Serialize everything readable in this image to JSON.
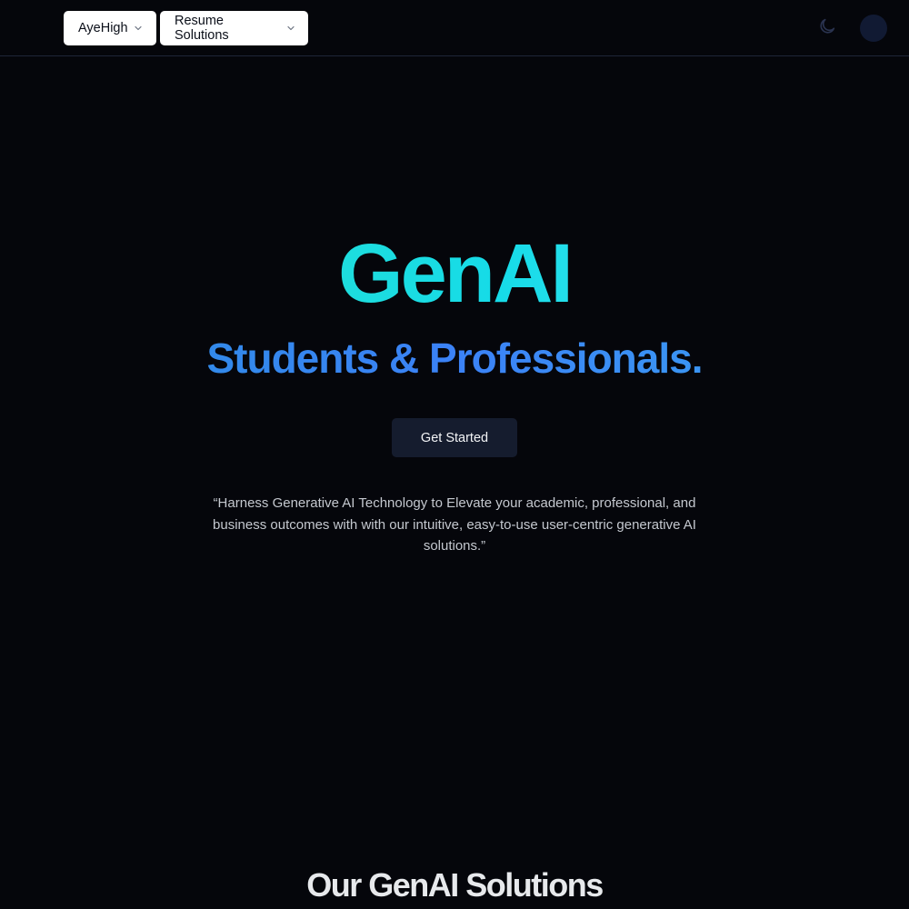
{
  "nav": {
    "menus": [
      {
        "label": "AyeHigh",
        "icon": "chevron-down-icon"
      },
      {
        "label": "Resume Solutions",
        "icon": "chevron-down-icon"
      }
    ],
    "theme_toggle_icon": "moon-icon",
    "avatar_icon": "avatar"
  },
  "hero": {
    "title": "GenAI",
    "subtitle": "Students & Professionals.",
    "cta_label": "Get Started",
    "quote": "“Harness Generative AI Technology to Elevate your academic, professional, and business outcomes with with our intuitive, easy-to-use user-centric generative AI solutions.”"
  },
  "solutions": {
    "title": "Our GenAI Solutions"
  },
  "colors": {
    "background": "#05060b",
    "title_gradient_start": "#2de2c8",
    "subtitle_blue": "#3b82f6",
    "cta_bg": "#151c2e"
  }
}
